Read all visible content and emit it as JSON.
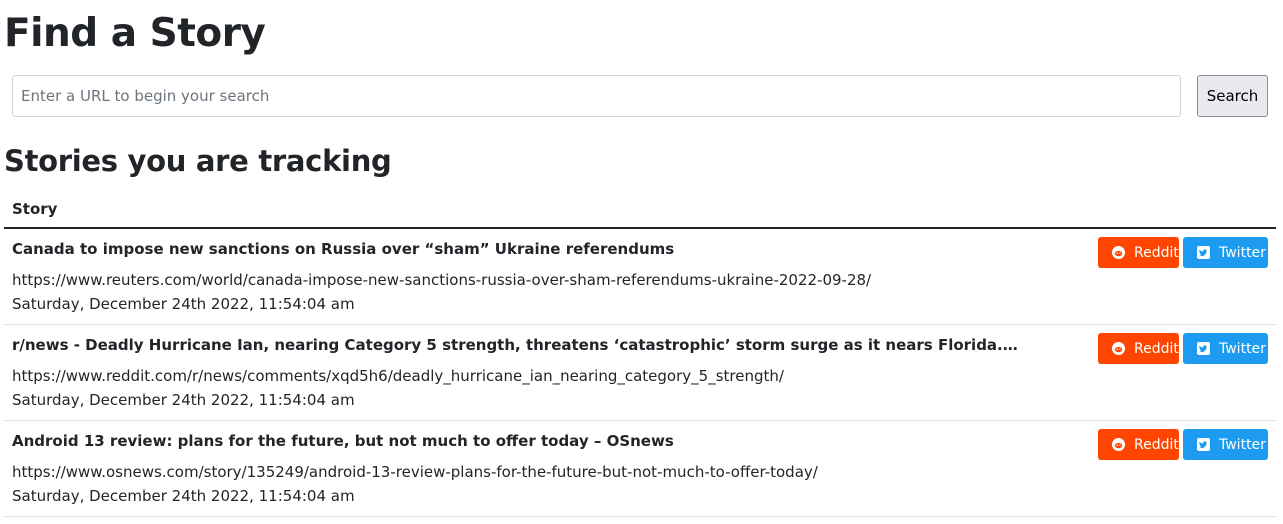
{
  "header": {
    "title": "Find a Story"
  },
  "search": {
    "placeholder": "Enter a URL to begin your search",
    "value": "",
    "button_label": "Search"
  },
  "tracking": {
    "title": "Stories you are tracking",
    "column_header": "Story",
    "share_labels": {
      "reddit": "Reddit",
      "twitter": "Twitter"
    },
    "colors": {
      "reddit": "#ff4500",
      "twitter": "#1d9bf0"
    },
    "stories": [
      {
        "title": "Canada to impose new sanctions on Russia over “sham” Ukraine referendums",
        "url": "https://www.reuters.com/world/canada-impose-new-sanctions-russia-over-sham-referendums-ukraine-2022-09-28/",
        "date": "Saturday, December 24th 2022, 11:54:04 am"
      },
      {
        "title": "r/news - Deadly Hurricane Ian, nearing Category 5 strength, threatens ‘catastrophic’ storm surge as it nears Florida. It’s too …",
        "url": "https://www.reddit.com/r/news/comments/xqd5h6/deadly_hurricane_ian_nearing_category_5_strength/",
        "date": "Saturday, December 24th 2022, 11:54:04 am"
      },
      {
        "title": "Android 13 review: plans for the future, but not much to offer today – OSnews",
        "url": "https://www.osnews.com/story/135249/android-13-review-plans-for-the-future-but-not-much-to-offer-today/",
        "date": "Saturday, December 24th 2022, 11:54:04 am"
      }
    ]
  }
}
